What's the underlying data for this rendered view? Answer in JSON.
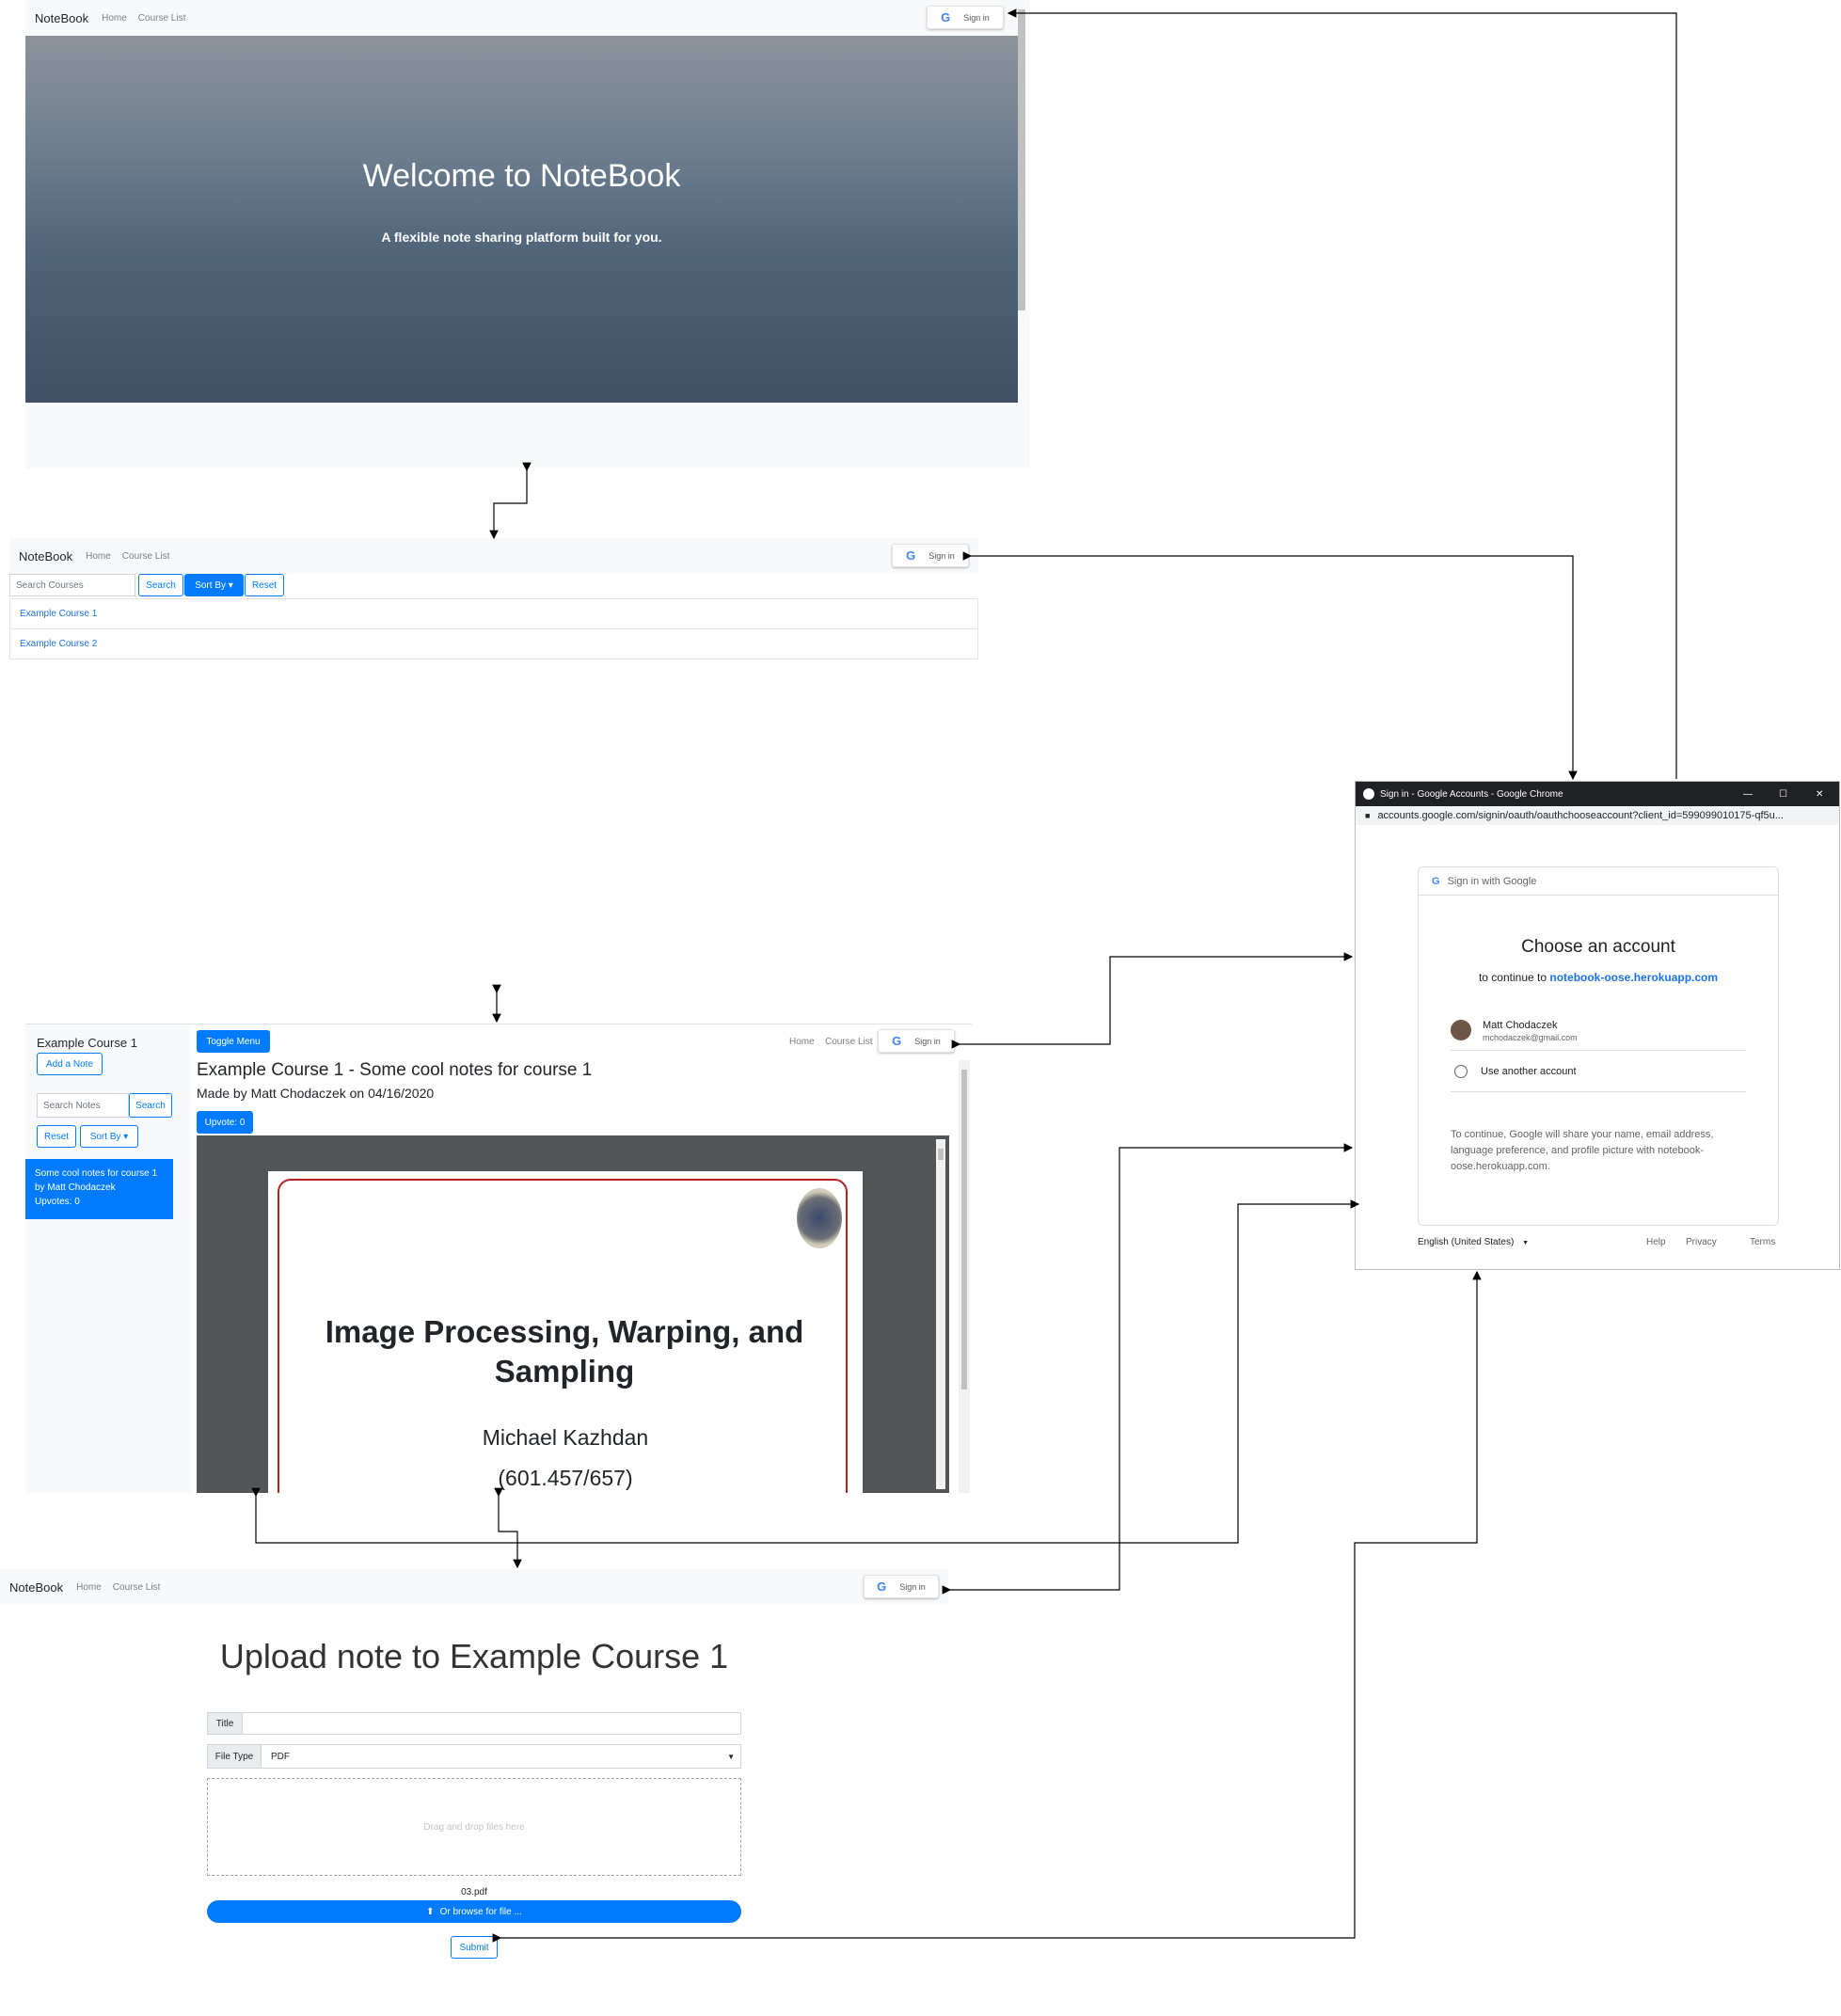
{
  "panel1": {
    "brand": "NoteBook",
    "nav": [
      "Home",
      "Course List"
    ],
    "signin": "Sign in",
    "hero_title": "Welcome to NoteBook",
    "hero_subtitle": "A flexible note sharing platform built for you."
  },
  "panel2": {
    "brand": "NoteBook",
    "nav": [
      "Home",
      "Course List"
    ],
    "signin": "Sign in",
    "search_placeholder": "Search Courses",
    "search_button": "Search",
    "sort_button": "Sort By ▾",
    "reset_button": "Reset",
    "courses": [
      "Example Course 1",
      "Example Course 2"
    ]
  },
  "panel3": {
    "sidebar_title": "Example Course 1",
    "add_note": "Add a Note",
    "search_placeholder": "Search Notes",
    "search_button": "Search",
    "reset_button": "Reset",
    "sort_button": "Sort By ▾",
    "note_item_text": "Some cool notes for course 1 by Matt Chodaczek",
    "note_item_upvotes": "Upvotes: 0",
    "toggle_menu": "Toggle Menu",
    "nav": [
      "Home",
      "Course List"
    ],
    "signin": "Sign in",
    "note_title": "Example Course 1 - Some cool notes for course 1",
    "note_meta": "Made by Matt Chodaczek on 04/16/2020",
    "upvote": "Upvote: 0",
    "slide_title": "Image Processing, Warping, and Sampling",
    "slide_author": "Michael Kazhdan",
    "slide_course": "(601.457/657)"
  },
  "panel4": {
    "brand": "NoteBook",
    "nav": [
      "Home",
      "Course List"
    ],
    "signin": "Sign in",
    "heading": "Upload note to Example Course 1",
    "title_label": "Title",
    "filetype_label": "File Type",
    "filetype_value": "PDF",
    "dropzone": "Drag and drop files here",
    "file_name": "03.pdf",
    "browse": "Or browse for file ...",
    "submit": "Submit"
  },
  "google": {
    "window_title": "Sign in - Google Accounts - Google Chrome",
    "url": "accounts.google.com/signin/oauth/oauthchooseaccount?client_id=599099010175-qf5u...",
    "header": "Sign in with Google",
    "choose": "Choose an account",
    "continue_prefix": "to continue to",
    "continue_site": "notebook-oose.herokuapp.com",
    "account_name": "Matt Chodaczek",
    "account_email": "mchodaczek@gmail.com",
    "another": "Use another account",
    "disclaimer": "To continue, Google will share your name, email address, language preference, and profile picture with notebook-oose.herokuapp.com.",
    "language": "English (United States)",
    "help": "Help",
    "privacy": "Privacy",
    "terms": "Terms"
  },
  "colors": {
    "primary": "#007bff",
    "navbar_bg": "#f8f9fa",
    "link_blue": "#1a73e8"
  }
}
